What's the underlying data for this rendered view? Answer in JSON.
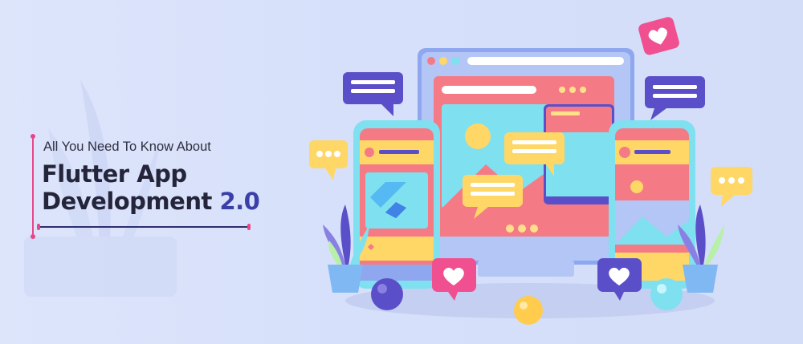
{
  "banner": {
    "subtitle": "All You Need To Know About",
    "title_line1": "Flutter App",
    "title_line2": "Development",
    "title_version": "2.0"
  },
  "colors": {
    "background": "#d8e2fb",
    "accent_pink": "#e8468b",
    "title_dark": "#24243a",
    "version_blue": "#3b3fa8",
    "panel_coral": "#f47b86",
    "panel_cyan": "#7fe0ef",
    "chat_purple": "#5b4fc9",
    "chat_yellow": "#ffd766",
    "flutter_blue": "#3f83e6"
  },
  "icons": [
    "flutter-logo-icon",
    "heart-icon",
    "chat-bubble-icon",
    "plant-icon",
    "sun-icon",
    "mountain-icon",
    "sphere-icon"
  ]
}
